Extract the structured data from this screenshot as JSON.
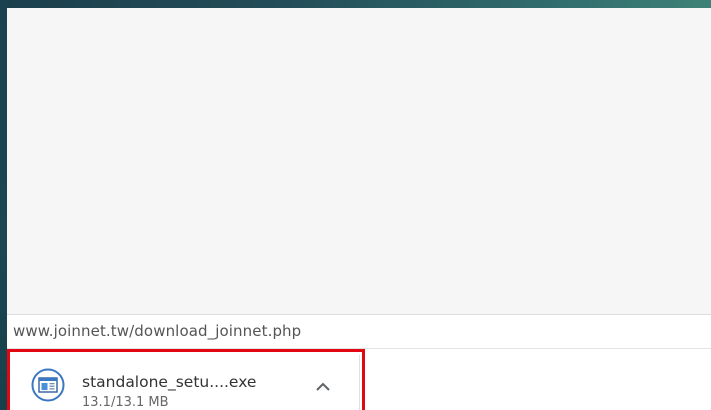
{
  "status_bar": {
    "url": "www.joinnet.tw/download_joinnet.php"
  },
  "download_shelf": {
    "item": {
      "file_name": "standalone_setu....exe",
      "progress": "13.1/13.1 MB",
      "icon": "installer-window-icon",
      "menu_icon": "chevron-up-icon"
    }
  },
  "colors": {
    "highlight_border": "#e30613",
    "icon_ring": "#3b78c4"
  }
}
